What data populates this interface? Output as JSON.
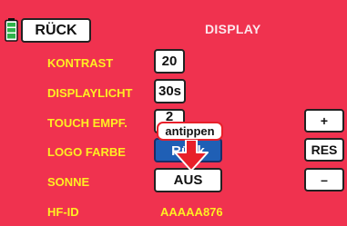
{
  "header": {
    "back_label": "RÜCK",
    "title": "DISPLAY",
    "battery_icon": "battery-icon"
  },
  "settings": {
    "contrast": {
      "label": "KONTRAST",
      "value": "20"
    },
    "backlight": {
      "label": "DISPLAYLICHT",
      "value": "30s"
    },
    "touch": {
      "label": "TOUCH EMPF.",
      "value": "2"
    },
    "logo_color": {
      "label": "LOGO FARBE",
      "value": "Rück"
    },
    "sun": {
      "label": "SONNE",
      "value": "AUS"
    },
    "hf_id": {
      "label": "HF-ID",
      "value": "AAAAA876"
    }
  },
  "side_buttons": {
    "plus": "+",
    "reset": "RES",
    "minus": "–"
  },
  "callout": {
    "text": "antippen"
  },
  "colors": {
    "background": "#f0324f",
    "label_yellow": "#ffee22",
    "selected_field": "#1f5fb5",
    "battery_green": "#2fb24a",
    "callout_red": "#e8202a"
  }
}
